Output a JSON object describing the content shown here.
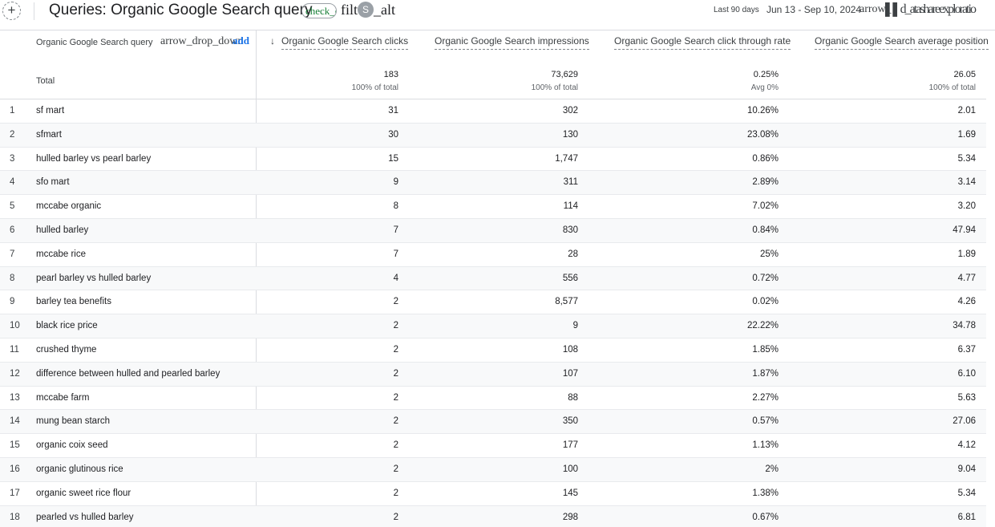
{
  "header": {
    "add_icon": "+",
    "title": "Queries: Organic Google Search query",
    "check_chip": "check_circle",
    "filter_prefix": "filt",
    "filter_avatar": "S",
    "filter_suffix": "_alt",
    "date_label": "Last 90 days",
    "date_range": "Jun 13 - Sep 10, 2024",
    "date_dropdown": "arrow_drop_down",
    "toolbar_text": "▌▌d_atashareexploratio"
  },
  "table": {
    "dimension_header": "Organic Google Search query",
    "dimension_dropdown": "arrow_drop_down",
    "dimension_add": "add",
    "sort_icon": "↓",
    "metric_headers": [
      "Organic Google Search clicks",
      "Organic Google Search impressions",
      "Organic Google Search click through rate",
      "Organic Google Search average position"
    ],
    "total_label": "Total",
    "totals": [
      {
        "value": "183",
        "sub": "100% of total"
      },
      {
        "value": "73,629",
        "sub": "100% of total"
      },
      {
        "value": "0.25%",
        "sub": "Avg 0%"
      },
      {
        "value": "26.05",
        "sub": "100% of total"
      }
    ],
    "rows": [
      {
        "idx": "1",
        "query": "sf mart",
        "clicks": "31",
        "impressions": "302",
        "ctr": "10.26%",
        "position": "2.01"
      },
      {
        "idx": "2",
        "query": "sfmart",
        "clicks": "30",
        "impressions": "130",
        "ctr": "23.08%",
        "position": "1.69"
      },
      {
        "idx": "3",
        "query": "hulled barley vs pearl barley",
        "clicks": "15",
        "impressions": "1,747",
        "ctr": "0.86%",
        "position": "5.34"
      },
      {
        "idx": "4",
        "query": "sfo mart",
        "clicks": "9",
        "impressions": "311",
        "ctr": "2.89%",
        "position": "3.14"
      },
      {
        "idx": "5",
        "query": "mccabe organic",
        "clicks": "8",
        "impressions": "114",
        "ctr": "7.02%",
        "position": "3.20"
      },
      {
        "idx": "6",
        "query": "hulled barley",
        "clicks": "7",
        "impressions": "830",
        "ctr": "0.84%",
        "position": "47.94"
      },
      {
        "idx": "7",
        "query": "mccabe rice",
        "clicks": "7",
        "impressions": "28",
        "ctr": "25%",
        "position": "1.89"
      },
      {
        "idx": "8",
        "query": "pearl barley vs hulled barley",
        "clicks": "4",
        "impressions": "556",
        "ctr": "0.72%",
        "position": "4.77"
      },
      {
        "idx": "9",
        "query": "barley tea benefits",
        "clicks": "2",
        "impressions": "8,577",
        "ctr": "0.02%",
        "position": "4.26"
      },
      {
        "idx": "10",
        "query": "black rice price",
        "clicks": "2",
        "impressions": "9",
        "ctr": "22.22%",
        "position": "34.78"
      },
      {
        "idx": "11",
        "query": "crushed thyme",
        "clicks": "2",
        "impressions": "108",
        "ctr": "1.85%",
        "position": "6.37"
      },
      {
        "idx": "12",
        "query": "difference between hulled and pearled barley",
        "clicks": "2",
        "impressions": "107",
        "ctr": "1.87%",
        "position": "6.10"
      },
      {
        "idx": "13",
        "query": "mccabe farm",
        "clicks": "2",
        "impressions": "88",
        "ctr": "2.27%",
        "position": "5.63"
      },
      {
        "idx": "14",
        "query": "mung bean starch",
        "clicks": "2",
        "impressions": "350",
        "ctr": "0.57%",
        "position": "27.06"
      },
      {
        "idx": "15",
        "query": "organic coix seed",
        "clicks": "2",
        "impressions": "177",
        "ctr": "1.13%",
        "position": "4.12"
      },
      {
        "idx": "16",
        "query": "organic glutinous rice",
        "clicks": "2",
        "impressions": "100",
        "ctr": "2%",
        "position": "9.04"
      },
      {
        "idx": "17",
        "query": "organic sweet rice flour",
        "clicks": "2",
        "impressions": "145",
        "ctr": "1.38%",
        "position": "5.34"
      },
      {
        "idx": "18",
        "query": "pearled vs hulled barley",
        "clicks": "2",
        "impressions": "298",
        "ctr": "0.67%",
        "position": "6.81"
      }
    ]
  }
}
